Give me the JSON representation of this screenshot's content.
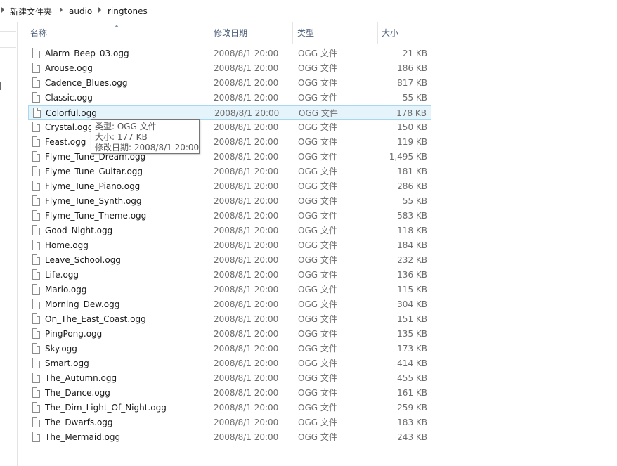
{
  "breadcrumb": [
    "新建文件夹",
    "audio",
    "ringtones"
  ],
  "columns": {
    "name": "名称",
    "date": "修改日期",
    "type": "类型",
    "size": "大小"
  },
  "files": [
    {
      "name": "Alarm_Beep_03.ogg",
      "date": "2008/8/1 20:00",
      "type": "OGG 文件",
      "size": "21 KB"
    },
    {
      "name": "Arouse.ogg",
      "date": "2008/8/1 20:00",
      "type": "OGG 文件",
      "size": "186 KB"
    },
    {
      "name": "Cadence_Blues.ogg",
      "date": "2008/8/1 20:00",
      "type": "OGG 文件",
      "size": "817 KB"
    },
    {
      "name": "Classic.ogg",
      "date": "2008/8/1 20:00",
      "type": "OGG 文件",
      "size": "55 KB"
    },
    {
      "name": "Colorful.ogg",
      "date": "2008/8/1 20:00",
      "type": "OGG 文件",
      "size": "178 KB"
    },
    {
      "name": "Crystal.ogg",
      "date": "2008/8/1 20:00",
      "type": "OGG 文件",
      "size": "150 KB"
    },
    {
      "name": "Feast.ogg",
      "date": "2008/8/1 20:00",
      "type": "OGG 文件",
      "size": "119 KB"
    },
    {
      "name": "Flyme_Tune_Dream.ogg",
      "date": "2008/8/1 20:00",
      "type": "OGG 文件",
      "size": "1,495 KB"
    },
    {
      "name": "Flyme_Tune_Guitar.ogg",
      "date": "2008/8/1 20:00",
      "type": "OGG 文件",
      "size": "181 KB"
    },
    {
      "name": "Flyme_Tune_Piano.ogg",
      "date": "2008/8/1 20:00",
      "type": "OGG 文件",
      "size": "286 KB"
    },
    {
      "name": "Flyme_Tune_Synth.ogg",
      "date": "2008/8/1 20:00",
      "type": "OGG 文件",
      "size": "55 KB"
    },
    {
      "name": "Flyme_Tune_Theme.ogg",
      "date": "2008/8/1 20:00",
      "type": "OGG 文件",
      "size": "583 KB"
    },
    {
      "name": "Good_Night.ogg",
      "date": "2008/8/1 20:00",
      "type": "OGG 文件",
      "size": "118 KB"
    },
    {
      "name": "Home.ogg",
      "date": "2008/8/1 20:00",
      "type": "OGG 文件",
      "size": "184 KB"
    },
    {
      "name": "Leave_School.ogg",
      "date": "2008/8/1 20:00",
      "type": "OGG 文件",
      "size": "232 KB"
    },
    {
      "name": "Life.ogg",
      "date": "2008/8/1 20:00",
      "type": "OGG 文件",
      "size": "136 KB"
    },
    {
      "name": "Mario.ogg",
      "date": "2008/8/1 20:00",
      "type": "OGG 文件",
      "size": "115 KB"
    },
    {
      "name": "Morning_Dew.ogg",
      "date": "2008/8/1 20:00",
      "type": "OGG 文件",
      "size": "304 KB"
    },
    {
      "name": "On_The_East_Coast.ogg",
      "date": "2008/8/1 20:00",
      "type": "OGG 文件",
      "size": "151 KB"
    },
    {
      "name": "PingPong.ogg",
      "date": "2008/8/1 20:00",
      "type": "OGG 文件",
      "size": "135 KB"
    },
    {
      "name": "Sky.ogg",
      "date": "2008/8/1 20:00",
      "type": "OGG 文件",
      "size": "173 KB"
    },
    {
      "name": "Smart.ogg",
      "date": "2008/8/1 20:00",
      "type": "OGG 文件",
      "size": "414 KB"
    },
    {
      "name": "The_Autumn.ogg",
      "date": "2008/8/1 20:00",
      "type": "OGG 文件",
      "size": "455 KB"
    },
    {
      "name": "The_Dance.ogg",
      "date": "2008/8/1 20:00",
      "type": "OGG 文件",
      "size": "161 KB"
    },
    {
      "name": "The_Dim_Light_Of_Night.ogg",
      "date": "2008/8/1 20:00",
      "type": "OGG 文件",
      "size": "259 KB"
    },
    {
      "name": "The_Dwarfs.ogg",
      "date": "2008/8/1 20:00",
      "type": "OGG 文件",
      "size": "183 KB"
    },
    {
      "name": "The_Mermaid.ogg",
      "date": "2008/8/1 20:00",
      "type": "OGG 文件",
      "size": "243 KB"
    }
  ],
  "selected_index": 4,
  "tooltip": {
    "type_line": "类型: OGG 文件",
    "size_line": "大小: 177 KB",
    "date_line": "修改日期: 2008/8/1 20:00"
  },
  "icons": {
    "breadcrumb_separator": "chevron-right-icon",
    "file": "file-icon",
    "sort": "sort-ascending-icon"
  },
  "colors": {
    "selection_bg": "#e5f3fb",
    "selection_border": "#a8d8f0",
    "header_text": "#4c607a",
    "meta_text": "#6d6d6d"
  }
}
